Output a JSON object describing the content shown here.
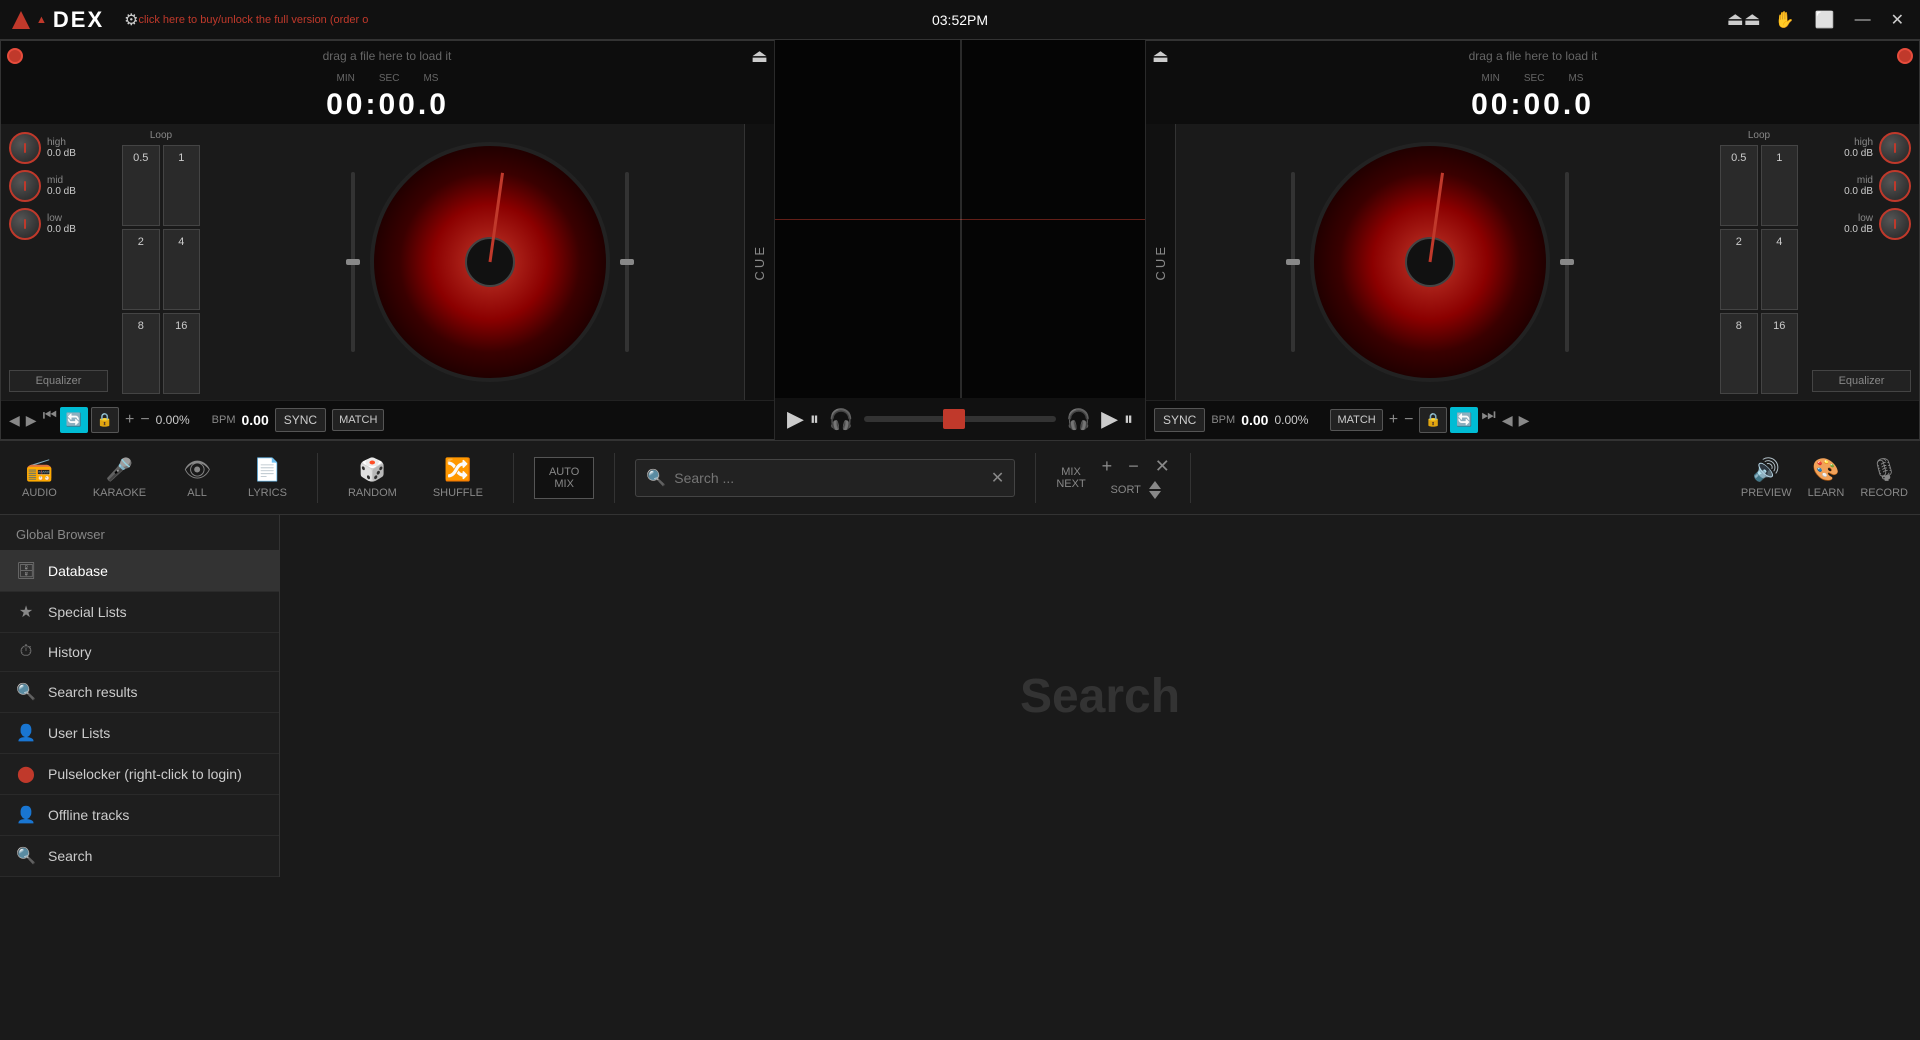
{
  "app": {
    "title": "DEX",
    "unlock_text": "click here to buy/unlock the full version (order o",
    "time": "03:52PM"
  },
  "titlebar": {
    "gear_label": "⚙",
    "eject_label": "⏏",
    "touch_label": "✋",
    "restore_label": "🗗",
    "minimize_label": "—",
    "close_label": "✕"
  },
  "deck_left": {
    "drag_text": "drag a file here to load it",
    "timer_min": "MIN",
    "timer_sec": "SEC",
    "timer_ms": "MS",
    "timer_value": "00:00.0",
    "eq_high_label": "high",
    "eq_high_val": "0.0 dB",
    "eq_mid_label": "mid",
    "eq_mid_val": "0.0 dB",
    "eq_low_label": "low",
    "eq_low_val": "0.0 dB",
    "eq_btn": "Equalizer",
    "loop_label": "Loop",
    "loop_btns": [
      "0.5",
      "1",
      "2",
      "4",
      "8",
      "16"
    ],
    "cue_label": "CUE",
    "sync_label": "SYNC",
    "bpm_label": "BPM",
    "bpm_value": "0.00",
    "pitch_pct": "0.00%",
    "match_label": "MATCH",
    "plus_label": "+",
    "minus_label": "−"
  },
  "deck_right": {
    "drag_text": "drag a file here to load it",
    "timer_min": "MIN",
    "timer_sec": "SEC",
    "timer_ms": "MS",
    "timer_value": "00:00.0",
    "eq_high_label": "high",
    "eq_high_val": "0.0 dB",
    "eq_mid_label": "mid",
    "eq_mid_val": "0.0 dB",
    "eq_low_label": "low",
    "eq_low_val": "0.0 dB",
    "eq_btn": "Equalizer",
    "loop_label": "Loop",
    "loop_btns": [
      "0.5",
      "1",
      "2",
      "4",
      "8",
      "16"
    ],
    "cue_label": "CUE",
    "sync_label": "SYNC",
    "bpm_label": "BPM",
    "bpm_value": "0.00",
    "pitch_pct": "0.00%",
    "match_label": "MATCH",
    "plus_label": "+",
    "minus_label": "−"
  },
  "toolbar": {
    "audio_label": "AUDIO",
    "karaoke_label": "KARAOKE",
    "all_label": "ALL",
    "lyrics_label": "LYRICS",
    "random_label": "RANDOM",
    "shuffle_label": "SHUFFLE",
    "automix_label": "AUTO\nMIX",
    "search_placeholder": "Search ...",
    "mix_next_label": "MIX\nNEXT",
    "sort_label": "SORT",
    "preview_label": "PREVIEW",
    "learn_label": "LEARN",
    "record_label": "RECORD"
  },
  "browser": {
    "header": "Global Browser",
    "items": [
      {
        "icon": "🗄",
        "label": "Database",
        "active": true
      },
      {
        "icon": "★",
        "label": "Special Lists",
        "active": false
      },
      {
        "icon": "⏱",
        "label": "History",
        "active": false
      },
      {
        "icon": "🔍",
        "label": "Search results",
        "active": false
      },
      {
        "icon": "👤",
        "label": "User Lists",
        "active": false
      },
      {
        "icon": "🔴",
        "label": "Pulselocker (right-click to login)",
        "active": false
      },
      {
        "icon": "👤",
        "label": "Offline tracks",
        "active": false
      },
      {
        "icon": "🔍",
        "label": "Search",
        "active": false
      }
    ]
  },
  "search_main": {
    "placeholder": "Search"
  }
}
